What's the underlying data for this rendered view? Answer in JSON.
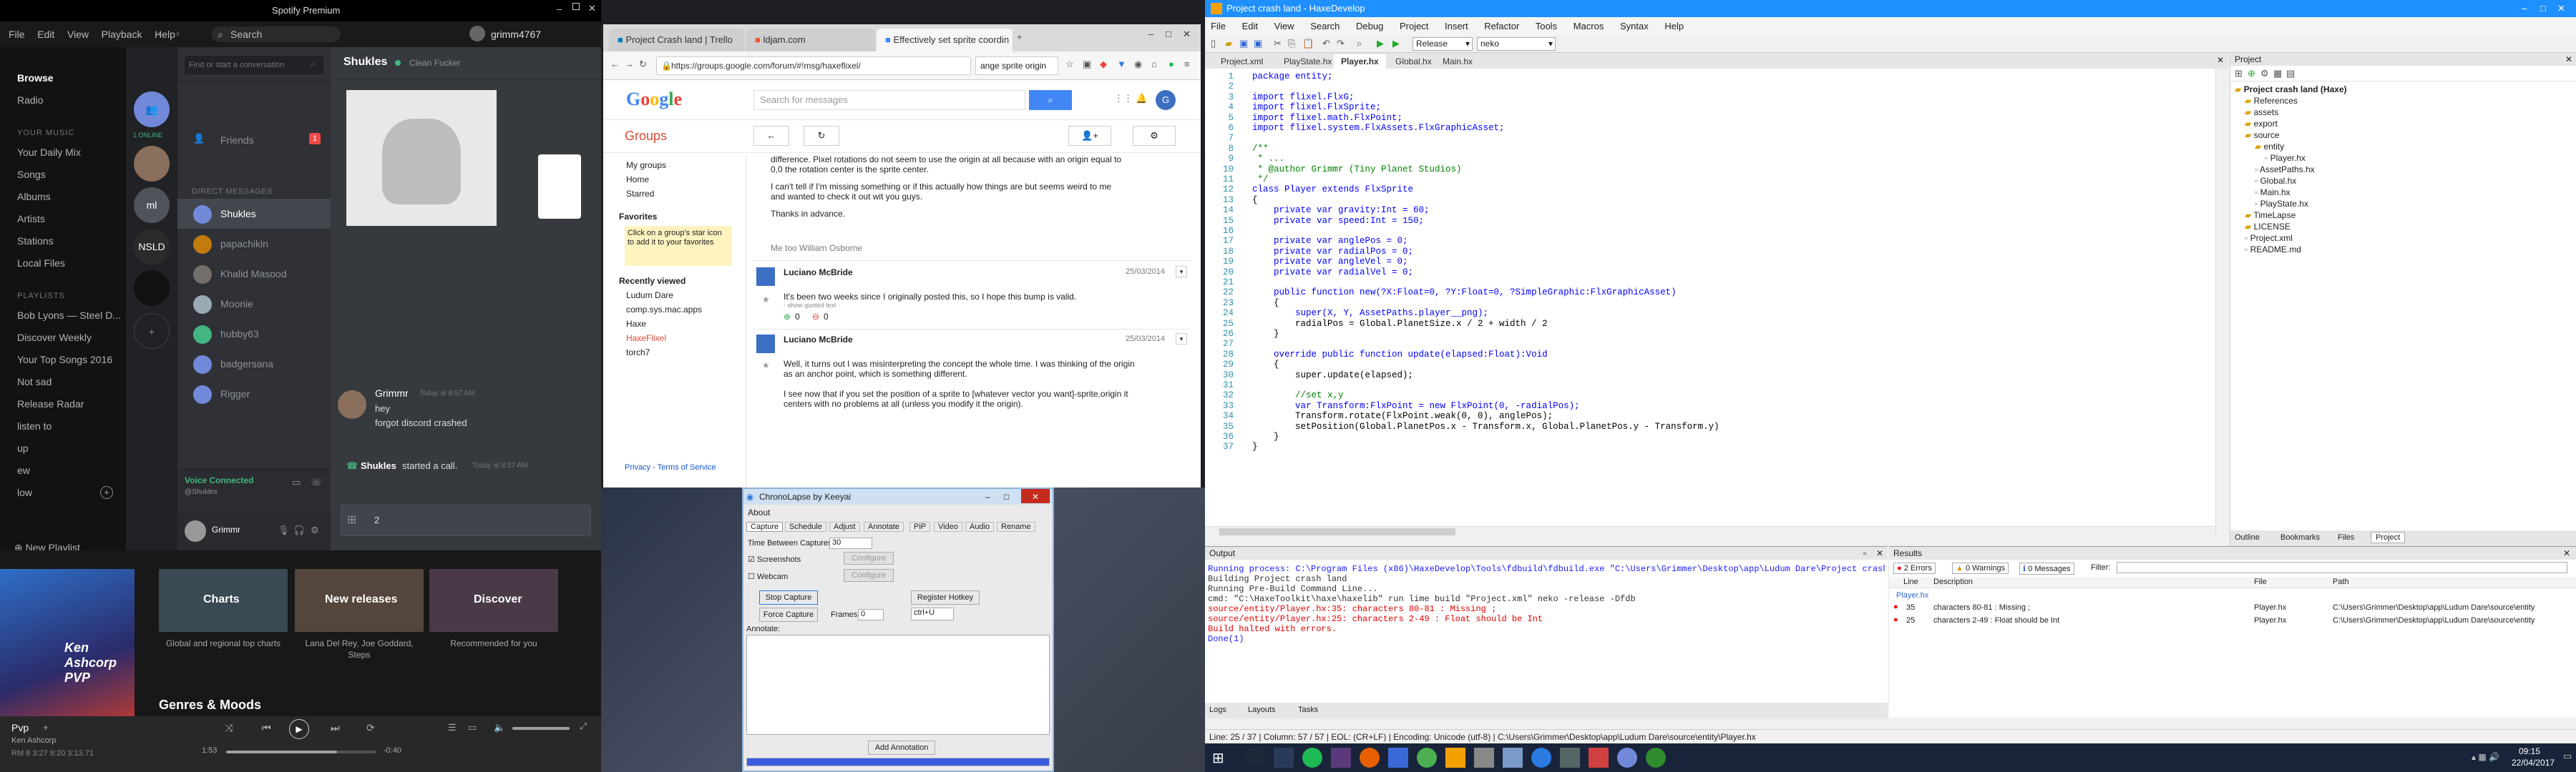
{
  "spotify": {
    "title": "Spotify Premium",
    "menu": [
      "File",
      "Edit",
      "View",
      "Playback",
      "Help"
    ],
    "search_placeholder": "Search",
    "username": "grimm4767",
    "nav": [
      "Browse",
      "Radio"
    ],
    "library_header": "YOUR MUSIC",
    "library": [
      "Your Daily Mix",
      "Songs",
      "Albums",
      "Artists",
      "Stations",
      "Local Files"
    ],
    "playlists_header": "PLAYLISTS",
    "playlists": [
      "Bob Lyons — Steel D...",
      "Discover Weekly",
      "Your Top Songs 2016",
      "Not sad",
      "Release Radar",
      "listen to",
      "up",
      "ew",
      "low"
    ],
    "new_playlist": "New Playlist",
    "tiles": [
      {
        "title": "Charts",
        "caption": "Global and regional top charts"
      },
      {
        "title": "New releases",
        "caption": "Lana Del Rey, Joe Goddard, Steps"
      },
      {
        "title": "Discover",
        "caption": "Recommended for you"
      }
    ],
    "section": "Genres & Moods",
    "now_playing": {
      "song": "Pvp",
      "artist": "Ken Ashcorp",
      "art_text": "Ken Ashcorp PVP",
      "time_elapsed": "1:53",
      "time_total": "-0:40"
    },
    "status_text": "RM 8 3:27 9:20 3:13.71"
  },
  "discord": {
    "find_placeholder": "Find or start a conversation",
    "friends": "Friends",
    "friends_badge": "1",
    "dm_header": "DIRECT MESSAGES",
    "dms": [
      "Shukles",
      "papachikin",
      "Khalid Masood",
      "Moonie",
      "hubby63",
      "badgersana",
      "Rigger"
    ],
    "guild_labels": [
      "1 ONLINE",
      "ml",
      "NSLD"
    ],
    "channel_name": "Shukles",
    "channel_status": "Clean Fucker",
    "message": {
      "author": "Grimmr",
      "time": "Today at 8:57 AM",
      "lines": [
        "hey",
        "forgot discord crashed"
      ]
    },
    "call": {
      "who": "Shukles",
      "text": "started a call.",
      "time": "Today at 8:57 AM"
    },
    "voice_status": "Voice Connected",
    "voice_sub": "@Shukles",
    "user": "Grimmr",
    "input_value": "2"
  },
  "chrome": {
    "tabs": [
      "Project Crash land | Trello",
      "ldjam.com",
      "Effectively set sprite coordin"
    ],
    "url": "https://groups.google.com/forum/#!msg/haxeflixel/",
    "search_box": "ange sprite origin",
    "google_search_placeholder": "Search for messages",
    "groups_label": "Groups",
    "nav": [
      "My groups",
      "Home",
      "Starred"
    ],
    "favorites_header": "Favorites",
    "favorites_hint": "Click on a group's star icon to add it to your favorites",
    "recent_header": "Recently viewed",
    "recent": [
      "Ludum Dare",
      "comp.sys.mac.apps",
      "Haxe",
      "HaxeFlixel",
      "torch7"
    ],
    "footer": "Privacy - Terms of Service",
    "post0_tail": [
      "difference. Pixel rotations do not seem to use the origin at all because with an origin equal to",
      "0,0 the rotation center is the sprite center.",
      "I can't tell if I'm missing something or if this actually how things are but seems weird to me",
      "and wanted to check it out wit you guys.",
      "Thanks in advance."
    ],
    "post0_meta": "Me too  William Osborne",
    "posts": [
      {
        "author": "Luciano McBride",
        "date": "25/03/2014",
        "body": [
          "It's been two weeks since I originally posted this, so I hope this bump is valid."
        ],
        "quoted": "- show quoted text -",
        "plus": "0",
        "minus": "0"
      },
      {
        "author": "Luciano McBride",
        "date": "25/03/2014",
        "body": [
          "Well, it turns out I was misinterpreting the concept the whole time. I was thinking of the origin",
          "as an anchor point, which is something different.",
          "",
          "I see now that if you set the position of a sprite to [whatever vector you want]-sprite.origin it",
          "centers with no problems at all (unless you modify it the origin)."
        ]
      }
    ]
  },
  "chrono": {
    "title": "ChronoLapse by Keeyai",
    "about": "About",
    "tabs": [
      "Capture",
      "Schedule",
      "Adjust",
      "Annotate",
      "PiP",
      "Video",
      "Audio",
      "Rename"
    ],
    "time_between": "Time Between Captures:",
    "time_value": "30",
    "screenshots": "Screenshots",
    "webcam": "Webcam",
    "configure": "Configure",
    "stop_capture": "Stop Capture",
    "register_hotkey": "Register Hotkey",
    "force_capture": "Force Capture",
    "frames_label": "Frames:",
    "frames_value": "0",
    "hotkey_value": "ctrl+U",
    "annotate_label": "Annotate:",
    "add_annotation": "Add Annotation"
  },
  "haxe": {
    "title": "Project crash land - HaxeDevelop",
    "menu": [
      "File",
      "Edit",
      "View",
      "Search",
      "Debug",
      "Project",
      "Insert",
      "Refactor",
      "Tools",
      "Macros",
      "Syntax",
      "Help"
    ],
    "build_config": "Release",
    "target": "neko",
    "tabs": [
      "Project.xml",
      "PlayState.hx",
      "Player.hx",
      "Global.hx",
      "Main.hx"
    ],
    "active_tab": "Player.hx",
    "code": [
      "package entity;",
      "",
      "import flixel.FlxG;",
      "import flixel.FlxSprite;",
      "import flixel.math.FlxPoint;",
      "import flixel.system.FlxAssets.FlxGraphicAsset;",
      "",
      "/**",
      " * ...",
      " * @author Grimmr (Tiny Planet Studios)",
      " */",
      "class Player extends FlxSprite",
      "{",
      "    private var gravity:Int = 60;",
      "    private var speed:Int = 150;",
      "",
      "    private var anglePos = 0;",
      "    private var radialPos = 0;",
      "    private var angleVel = 0;",
      "    private var radialVel = 0;",
      "",
      "    public function new(?X:Float=0, ?Y:Float=0, ?SimpleGraphic:FlxGraphicAsset)",
      "    {",
      "        super(X, Y, AssetPaths.player__png);",
      "        radialPos = Global.PlanetSize.x / 2 + width / 2",
      "    }",
      "",
      "    override public function update(elapsed:Float):Void",
      "    {",
      "        super.update(elapsed);",
      "",
      "        //set x,y",
      "        var Transform:FlxPoint = new FlxPoint(0, -radialPos);",
      "        Transform.rotate(FlxPoint.weak(0, 0), anglePos);",
      "        setPosition(Global.PlanetPos.x - Transform.x, Global.PlanetPos.y - Transform.y)",
      "    }",
      "}"
    ],
    "project_title": "Project",
    "tree": [
      {
        "label": "Project crash land (Haxe)",
        "depth": 0
      },
      {
        "label": "References",
        "depth": 1
      },
      {
        "label": "assets",
        "depth": 1
      },
      {
        "label": "export",
        "depth": 1
      },
      {
        "label": "source",
        "depth": 1
      },
      {
        "label": "entity",
        "depth": 2
      },
      {
        "label": "Player.hx",
        "depth": 3
      },
      {
        "label": "AssetPaths.hx",
        "depth": 2
      },
      {
        "label": "Global.hx",
        "depth": 2
      },
      {
        "label": "Main.hx",
        "depth": 2
      },
      {
        "label": "PlayState.hx",
        "depth": 2
      },
      {
        "label": "TimeLapse",
        "depth": 1
      },
      {
        "label": "LICENSE",
        "depth": 1
      },
      {
        "label": "Project.xml",
        "depth": 1
      },
      {
        "label": "README.md",
        "depth": 1
      }
    ],
    "side_tabs": [
      "Outline",
      "Bookmarks",
      "Files",
      "Project"
    ],
    "output_title": "Output",
    "output": [
      {
        "text": "Running process: C:\\Program Files (x86)\\HaxeDevelop\\Tools\\fdbuild\\fdbuild.exe \"C:\\Users\\Grimmer\\Desktop\\app\\Ludum Dare\\Project crash lan",
        "color": "#1a1aff"
      },
      {
        "text": "Building Project crash land",
        "color": "#333"
      },
      {
        "text": "Running Pre-Build Command Line...",
        "color": "#333"
      },
      {
        "text": "cmd: \"C:\\HaxeToolkit\\haxe\\haxelib\" run lime build \"Project.xml\" neko -release -Dfdb",
        "color": "#333"
      },
      {
        "text": "source/entity/Player.hx:35: characters 80-81 : Missing ;",
        "color": "#e00000"
      },
      {
        "text": "source/entity/Player.hx:25: characters 2-49 : Float should be Int",
        "color": "#e00000"
      },
      {
        "text": "Build halted with errors.",
        "color": "#e00000"
      },
      {
        "text": "Done(1)",
        "color": "#1a1aff"
      }
    ],
    "results_title": "Results",
    "filters": [
      "2 Errors",
      "0 Warnings",
      "0 Messages"
    ],
    "filter_label": "Filter:",
    "result_cols": [
      "Line",
      "Description",
      "File",
      "Path"
    ],
    "result_group": "Player.hx",
    "results": [
      {
        "line": "35",
        "desc": "characters 80-81 : Missing ;",
        "file": "Player.hx",
        "path": "C:\\Users\\Grimmer\\Desktop\\app\\Ludum Dare\\source\\entity"
      },
      {
        "line": "25",
        "desc": "characters 2-49 : Float should be Int",
        "file": "Player.hx",
        "path": "C:\\Users\\Grimmer\\Desktop\\app\\Ludum Dare\\source\\entity"
      }
    ],
    "bottom_tabs": [
      "Logs",
      "Layouts",
      "Tasks"
    ],
    "status": "Line: 25 / 37 | Column: 57 / 57 | EOL: (CR+LF) | Encoding: Unicode (utf-8) | C:\\Users\\Grimmer\\Desktop\\app\\Ludum Dare\\source\\entity\\Player.hx"
  },
  "taskbar": {
    "time": "09:15",
    "date": "22/04/2017"
  }
}
